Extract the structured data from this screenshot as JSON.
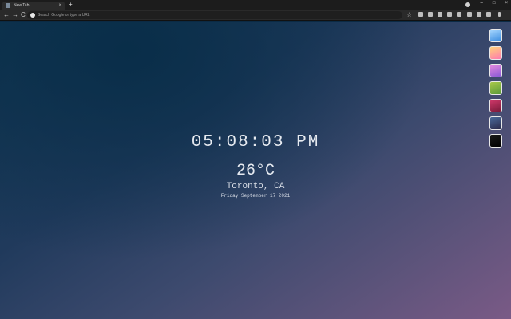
{
  "browser": {
    "tab_title": "New Tab",
    "close_glyph": "×",
    "newtab_glyph": "+",
    "search_placeholder": "Search Google or type a URL",
    "min_glyph": "–",
    "max_glyph": "□",
    "winclose_glyph": "×",
    "back_glyph": "←",
    "forward_glyph": "→",
    "reload_glyph": "C",
    "star_glyph": "☆"
  },
  "clock": {
    "time": "05:08:03 PM",
    "temperature": "26°C",
    "location": "Toronto, CA",
    "date": "Friday September 17 2021"
  },
  "theme_swatches": [
    {
      "name": "sky",
      "from": "#a8d8ff",
      "to": "#3a8ce0"
    },
    {
      "name": "sunset",
      "from": "#ffd27a",
      "to": "#ff7ab0"
    },
    {
      "name": "violet",
      "from": "#e58adf",
      "to": "#8a5ad8"
    },
    {
      "name": "lime",
      "from": "#a8c84a",
      "to": "#5a9a3a"
    },
    {
      "name": "crimson",
      "from": "#d0386a",
      "to": "#7a1a3a"
    },
    {
      "name": "dusk",
      "from": "#4a6a9a",
      "to": "#2a2a4a"
    },
    {
      "name": "black",
      "from": "#1a1a1a",
      "to": "#000000"
    }
  ]
}
